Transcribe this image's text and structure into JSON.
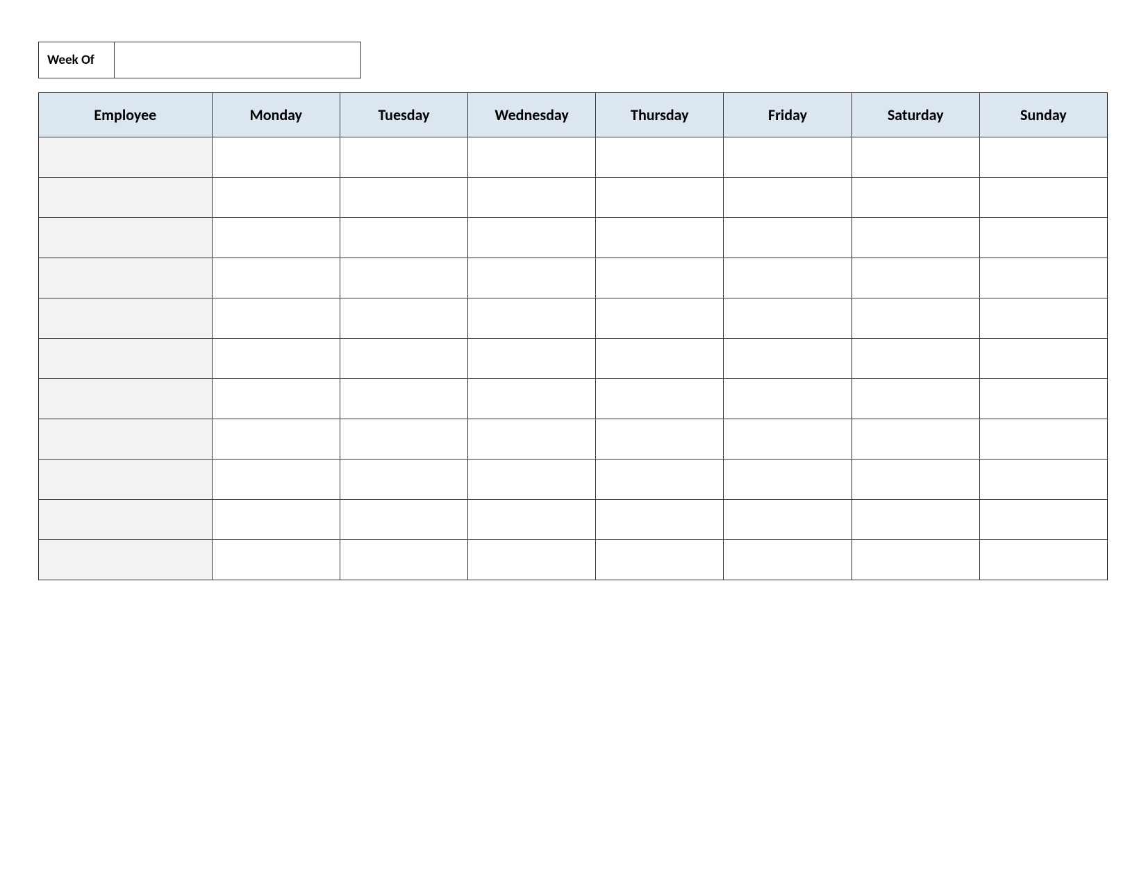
{
  "header": {
    "week_of_label": "Week Of",
    "week_of_value": ""
  },
  "table": {
    "columns": [
      "Employee",
      "Monday",
      "Tuesday",
      "Wednesday",
      "Thursday",
      "Friday",
      "Saturday",
      "Sunday"
    ],
    "rows": [
      {
        "employee": "",
        "monday": "",
        "tuesday": "",
        "wednesday": "",
        "thursday": "",
        "friday": "",
        "saturday": "",
        "sunday": ""
      },
      {
        "employee": "",
        "monday": "",
        "tuesday": "",
        "wednesday": "",
        "thursday": "",
        "friday": "",
        "saturday": "",
        "sunday": ""
      },
      {
        "employee": "",
        "monday": "",
        "tuesday": "",
        "wednesday": "",
        "thursday": "",
        "friday": "",
        "saturday": "",
        "sunday": ""
      },
      {
        "employee": "",
        "monday": "",
        "tuesday": "",
        "wednesday": "",
        "thursday": "",
        "friday": "",
        "saturday": "",
        "sunday": ""
      },
      {
        "employee": "",
        "monday": "",
        "tuesday": "",
        "wednesday": "",
        "thursday": "",
        "friday": "",
        "saturday": "",
        "sunday": ""
      },
      {
        "employee": "",
        "monday": "",
        "tuesday": "",
        "wednesday": "",
        "thursday": "",
        "friday": "",
        "saturday": "",
        "sunday": ""
      },
      {
        "employee": "",
        "monday": "",
        "tuesday": "",
        "wednesday": "",
        "thursday": "",
        "friday": "",
        "saturday": "",
        "sunday": ""
      },
      {
        "employee": "",
        "monday": "",
        "tuesday": "",
        "wednesday": "",
        "thursday": "",
        "friday": "",
        "saturday": "",
        "sunday": ""
      },
      {
        "employee": "",
        "monday": "",
        "tuesday": "",
        "wednesday": "",
        "thursday": "",
        "friday": "",
        "saturday": "",
        "sunday": ""
      },
      {
        "employee": "",
        "monday": "",
        "tuesday": "",
        "wednesday": "",
        "thursday": "",
        "friday": "",
        "saturday": "",
        "sunday": ""
      },
      {
        "employee": "",
        "monday": "",
        "tuesday": "",
        "wednesday": "",
        "thursday": "",
        "friday": "",
        "saturday": "",
        "sunday": ""
      }
    ]
  }
}
